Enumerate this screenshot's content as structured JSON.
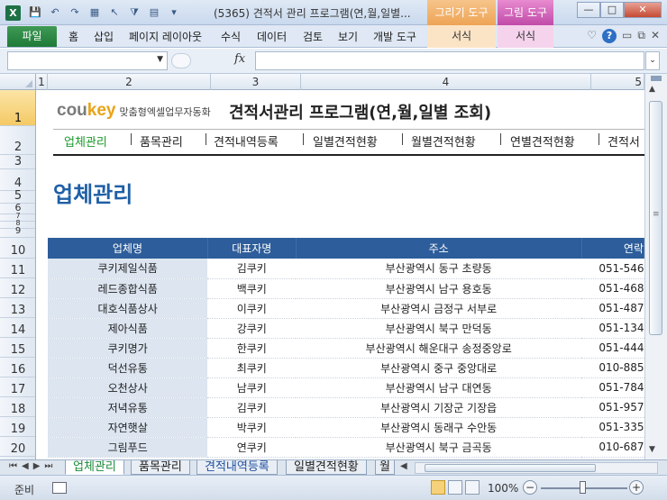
{
  "window": {
    "app_icon": "X",
    "title": "(5365) 견적서 관리 프로그램(연,월,일별...",
    "context_tab_drawing": "그리기 도구",
    "context_tab_picture": "그림 도구",
    "min_label": "—",
    "max_label": "□",
    "close_label": "✕"
  },
  "ribbon": {
    "file_tab": "파일",
    "tabs": [
      "홈",
      "삽입",
      "페이지 레이아웃",
      "수식",
      "데이터",
      "검토",
      "보기",
      "개발 도구"
    ],
    "context_format_1": "서식",
    "context_format_2": "서식",
    "help_label": "?"
  },
  "formula_bar": {
    "fx_label": "fx",
    "name_box_value": "",
    "formula_value": ""
  },
  "columns": [
    "1",
    "2",
    "3",
    "4",
    "5"
  ],
  "rows": [
    "1",
    "2",
    "3",
    "4",
    "5",
    "6",
    "7",
    "8",
    "9",
    "10",
    "11",
    "12",
    "13",
    "14",
    "15",
    "16",
    "17",
    "18",
    "19",
    "20"
  ],
  "sheet": {
    "brand_logo": "coukey",
    "brand_sub": "맞춤형엑셀업무자동화",
    "title": "견적서관리 프로그램(연,월,일별 조회)",
    "nav": [
      "업체관리",
      "품목관리",
      "견적내역등록",
      "일별견적현황",
      "월별견적현황",
      "연별견적현황",
      "견적서"
    ],
    "page_heading": "업체관리",
    "table_headers": [
      "업체명",
      "대표자명",
      "주소",
      "연락"
    ],
    "table_rows": [
      [
        "쿠키제일식품",
        "김쿠키",
        "부산광역시 동구 초량동",
        "051-546"
      ],
      [
        "레드종합식품",
        "백쿠키",
        "부산광역시 남구 용호동",
        "051-468"
      ],
      [
        "대호식품상사",
        "이쿠키",
        "부산광역시 금정구 서부로",
        "051-487"
      ],
      [
        "제아식품",
        "강쿠키",
        "부산광역시 북구 만덕동",
        "051-134"
      ],
      [
        "쿠키명가",
        "한쿠키",
        "부산광역시 해운대구 송정중앙로",
        "051-444"
      ],
      [
        "덕선유통",
        "최쿠키",
        "부산광역시 중구 중앙대로",
        "010-885"
      ],
      [
        "오천상사",
        "남쿠키",
        "부산광역시 남구 대연동",
        "051-784"
      ],
      [
        "저녁유통",
        "김쿠키",
        "부산광역시 기장군 기장읍",
        "051-957"
      ],
      [
        "자연햇살",
        "박쿠키",
        "부산광역시 동래구 수안동",
        "051-335"
      ],
      [
        "그림푸드",
        "연쿠키",
        "부산광역시 북구 금곡동",
        "010-687"
      ]
    ]
  },
  "sheet_tabs": [
    "업체관리",
    "품목관리",
    "견적내역등록",
    "일별견적현황",
    "월"
  ],
  "status": {
    "ready": "준비",
    "zoom": "100%",
    "zoom_minus": "−",
    "zoom_plus": "+"
  },
  "colors": {
    "header_fill": "#2d5d9a",
    "company_col_fill": "#dce5f0",
    "heading_blue": "#1f5fa6",
    "nav_active_green": "#1a9a2a",
    "file_tab_green": "#1f7a38",
    "brand_cou": "#7a7a7a",
    "brand_key": "#e8a317"
  }
}
